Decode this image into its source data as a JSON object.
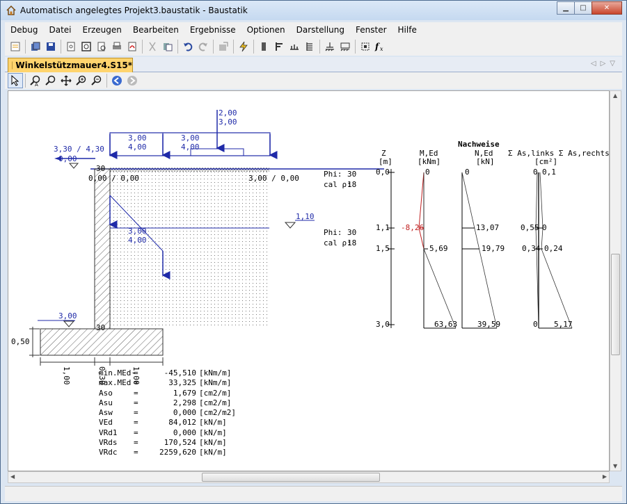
{
  "window": {
    "title": "Automatisch angelegtes Projekt3.baustatik - Baustatik",
    "icon": "house-icon",
    "buttons": [
      "minimize-icon",
      "maximize-icon",
      "close-icon"
    ]
  },
  "menu": [
    "Debug",
    "Datei",
    "Erzeugen",
    "Bearbeiten",
    "Ergebnisse",
    "Optionen",
    "Darstellung",
    "Fenster",
    "Hilfe"
  ],
  "toolbar_icons": [
    "new-icon",
    "copy-icon",
    "save-icon",
    "page-icon",
    "preview-icon",
    "print-preview-icon",
    "print-icon",
    "pdf-icon",
    "cut-icon",
    "paste-icon",
    "undo-icon",
    "redo-icon",
    "export-icon",
    "calculate-icon",
    "column-icon",
    "beam-icon",
    "load-icon",
    "wall-icon",
    "foundation-icon",
    "frame-icon",
    "select-box-icon",
    "formula-icon"
  ],
  "document_tab": {
    "label": "Winkelstützmauer4.S15*"
  },
  "view_tools": [
    "pointer-icon",
    "zoom-in-icon",
    "zoom-icon",
    "pan-icon",
    "zoom-plus-icon",
    "zoom-minus-icon",
    "back-icon",
    "forward-icon"
  ],
  "drawing": {
    "top_load": [
      "2,00",
      "3,00"
    ],
    "strip_load_left": [
      "3,00",
      "4,00"
    ],
    "strip_load_right": [
      "3,00",
      "4,00"
    ],
    "left_load": "3,30 / 4,30",
    "left_level": "0,00",
    "wall_top_label": "30",
    "wall_bottom_label": "30",
    "ground_left": "0,00 / 0,00",
    "ground_right": "3,00 / 0,00",
    "soil1": {
      "phi_label": "Phi:",
      "phi": "30",
      "rho_label": "cal ρ:",
      "rho": "18"
    },
    "soil2": {
      "phi_label": "Phi:",
      "phi": "30",
      "rho_label": "cal ρ:",
      "rho": "18"
    },
    "water_level": "1,10",
    "earth_load": [
      "3,00",
      "4,00"
    ],
    "toe_level": "3,00",
    "footing_height": "0,50",
    "dim_labels": [
      "1,00",
      "0,30",
      "1,00"
    ]
  },
  "diagrams": {
    "title": "Nachweise",
    "z_header": [
      "Z",
      "[m]"
    ],
    "m_header": [
      "M,Ed",
      "[kNm]"
    ],
    "n_header": [
      "N,Ed",
      "[kN]"
    ],
    "as_header": [
      "Σ As,links Σ As,rechts",
      "[cm²]"
    ],
    "z_ticks": [
      "0,0",
      "1,1",
      "1,5",
      "3,0"
    ],
    "m_values": [
      "0",
      "-8,26",
      "5,69",
      "63,63"
    ],
    "n_values": [
      "0",
      "13,07",
      "19,79",
      "39,59"
    ],
    "as_left": [
      "0",
      "0,55",
      "0,34",
      "0"
    ],
    "as_right": [
      "0,1",
      "0",
      "0,24",
      "5,17"
    ]
  },
  "results": [
    {
      "name": "min.MEd",
      "eq": "=",
      "value": "-45,510",
      "unit": "[kNm/m]"
    },
    {
      "name": "max.MEd",
      "eq": "=",
      "value": "33,325",
      "unit": "[kNm/m]"
    },
    {
      "name": "Aso",
      "eq": "=",
      "value": "1,679",
      "unit": "[cm2/m]"
    },
    {
      "name": "Asu",
      "eq": "=",
      "value": "2,298",
      "unit": "[cm2/m]"
    },
    {
      "name": "Asw",
      "eq": "=",
      "value": "0,000",
      "unit": "[cm2/m2]"
    },
    {
      "name": "VEd",
      "eq": "=",
      "value": "84,012",
      "unit": "[kN/m]"
    },
    {
      "name": "VRd1",
      "eq": "=",
      "value": "0,000",
      "unit": "[kN/m]"
    },
    {
      "name": "VRds",
      "eq": "=",
      "value": "170,524",
      "unit": "[kN/m]"
    },
    {
      "name": "VRdc",
      "eq": "=",
      "value": "2259,620",
      "unit": "[kN/m]"
    }
  ],
  "colors": {
    "load": "#1f2aa8",
    "moment_neg": "#c02020",
    "tab": "#ffd46e"
  }
}
